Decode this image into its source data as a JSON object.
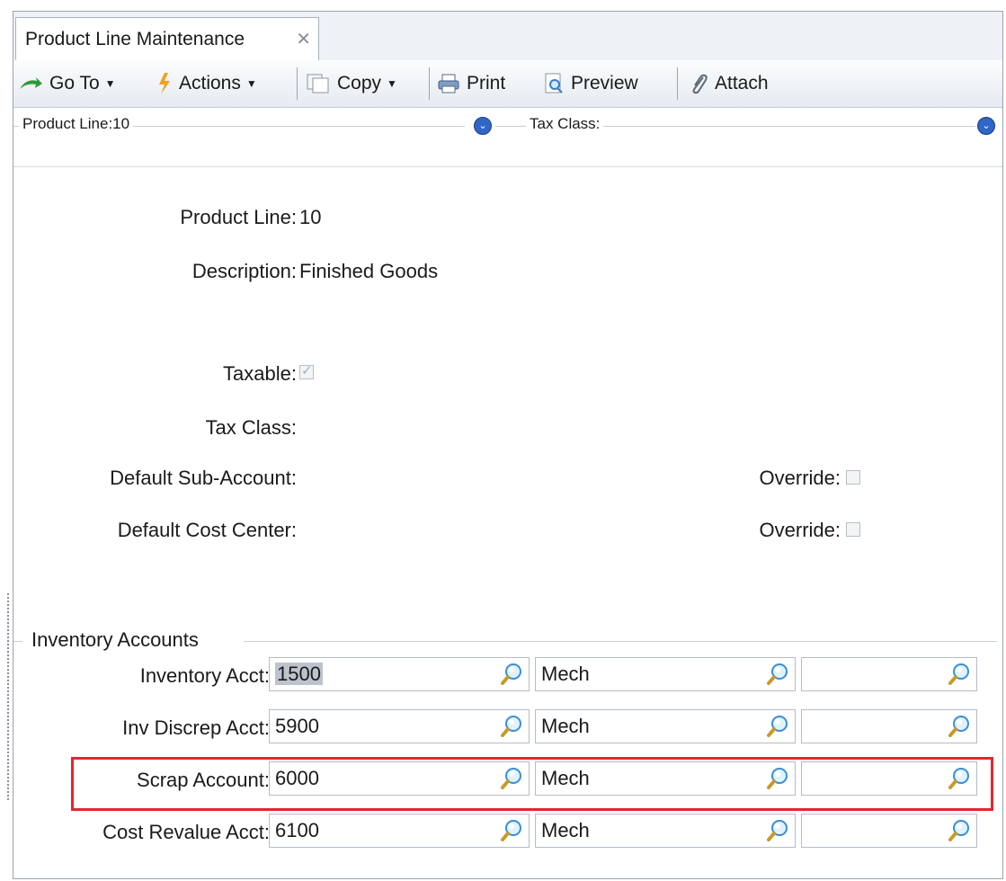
{
  "tab": {
    "title": "Product Line Maintenance",
    "close_glyph": "✕"
  },
  "toolbar": {
    "goto": "Go To",
    "actions": "Actions",
    "copy": "Copy",
    "print": "Print",
    "preview": "Preview",
    "attach": "Attach"
  },
  "collapse": {
    "product_line": "Product Line:10",
    "tax_class": "Tax Class:"
  },
  "form": {
    "product_line_label": "Product Line:",
    "product_line_value": "10",
    "description_label": "Description:",
    "description_value": "Finished Goods",
    "taxable_label": "Taxable:",
    "taxable_checked": true,
    "tax_class_label": "Tax Class:",
    "default_sub_account_label": "Default Sub-Account:",
    "default_cost_center_label": "Default Cost Center:",
    "override_label": "Override:"
  },
  "inventory": {
    "group_label": "Inventory Accounts",
    "rows": [
      {
        "label": "Inventory Acct:",
        "account": "1500",
        "sub": "Mech",
        "third": ""
      },
      {
        "label": "Inv Discrep Acct:",
        "account": "5900",
        "sub": "Mech",
        "third": ""
      },
      {
        "label": "Scrap Account:",
        "account": "6000",
        "sub": "Mech",
        "third": ""
      },
      {
        "label": "Cost Revalue Acct:",
        "account": "6100",
        "sub": "Mech",
        "third": ""
      }
    ]
  },
  "colors": {
    "highlight": "#e8242d",
    "accent": "#2f66c8"
  }
}
